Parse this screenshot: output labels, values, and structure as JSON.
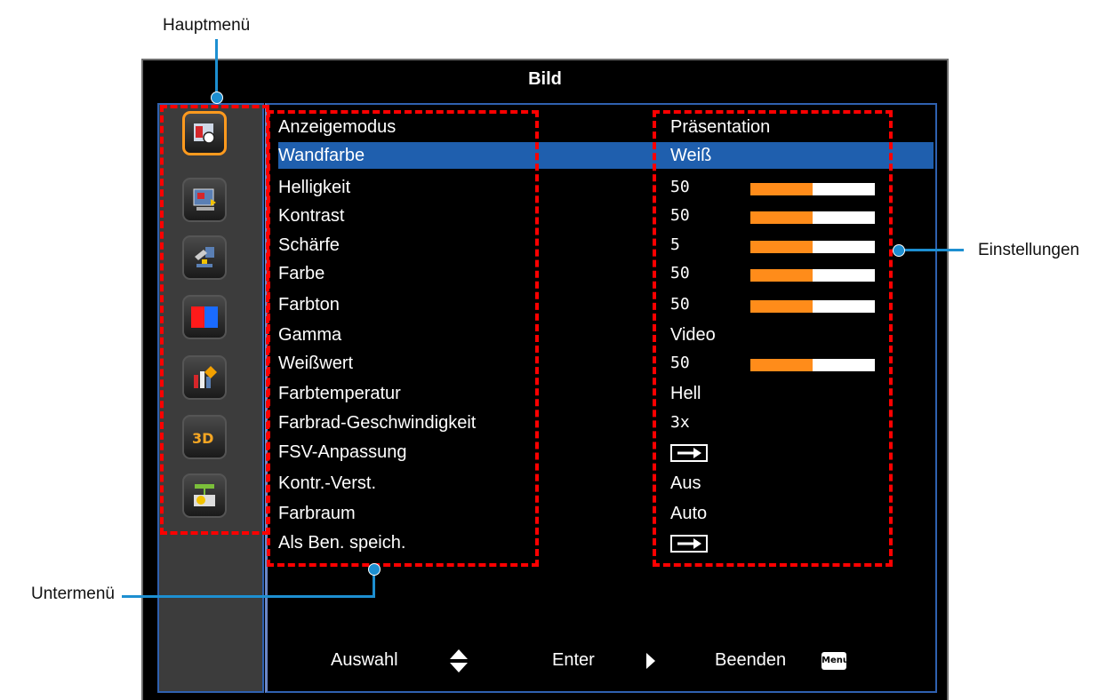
{
  "callouts": {
    "hauptmenu": "Hauptmenü",
    "untermenu": "Untermenü",
    "einstellungen": "Einstellungen"
  },
  "osd": {
    "title": "Bild",
    "sidebar_icons": [
      "picture-icon",
      "display-icon",
      "setup-icon",
      "color-icon",
      "info-icon",
      "3d-icon",
      "network-icon"
    ],
    "rows": [
      {
        "label": "Anzeigemodus",
        "value": "Präsentation"
      },
      {
        "label": "Wandfarbe",
        "value": "Weiß",
        "highlighted": true
      },
      {
        "label": "Helligkeit",
        "value": "50",
        "bar": 0.5
      },
      {
        "label": "Kontrast",
        "value": "50",
        "bar": 0.5
      },
      {
        "label": "Schärfe",
        "value": "5",
        "bar": 0.5
      },
      {
        "label": "Farbe",
        "value": "50",
        "bar": 0.5
      },
      {
        "label": "Farbton",
        "value": "50",
        "bar": 0.5
      },
      {
        "label": "Gamma",
        "value": "Video"
      },
      {
        "label": "Weißwert",
        "value": "50",
        "bar": 0.5
      },
      {
        "label": "Farbtemperatur",
        "value": "Hell"
      },
      {
        "label": "Farbrad-Geschwindigkeit",
        "value": "3x"
      },
      {
        "label": "FSV-Anpassung",
        "value": "arrow-icon"
      },
      {
        "label": "Kontr.-Verst.",
        "value": "Aus"
      },
      {
        "label": "Farbraum",
        "value": "Auto"
      },
      {
        "label": "Als Ben. speich.",
        "value": "arrow-icon"
      }
    ],
    "footer": {
      "select": "Auswahl",
      "enter": "Enter",
      "exit": "Beenden",
      "menu_key": "Menu"
    }
  },
  "colors": {
    "highlight": "#1f5fae",
    "slider_fill": "#ff8c1a",
    "active_icon_border": "#ff9a1e",
    "callout_line": "#1d8fd1",
    "dash": "#ff0000"
  }
}
